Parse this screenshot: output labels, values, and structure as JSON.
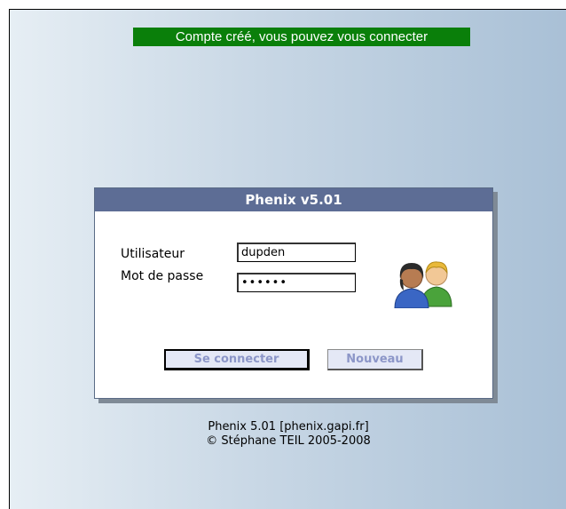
{
  "message": {
    "text": "Compte créé, vous pouvez vous connecter",
    "color": "#0a7f0a"
  },
  "panel": {
    "title": "Phenix v5.01",
    "header_color": "#5d6d95"
  },
  "form": {
    "username_label": "Utilisateur",
    "username_value": "dupden",
    "password_label": "Mot de passe",
    "password_value": "secret",
    "login_button": "Se connecter",
    "new_button": "Nouveau"
  },
  "icons": {
    "users": "users-icon"
  },
  "footer": {
    "line1": "Phenix 5.01 [phenix.gapi.fr]",
    "line2": "© Stéphane TEIL 2005-2008"
  }
}
